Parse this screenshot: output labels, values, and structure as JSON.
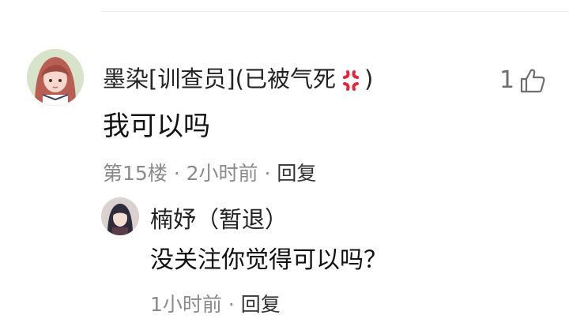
{
  "comment": {
    "username_prefix": "墨染[训查员](已被气死",
    "username_suffix": ")",
    "likes": "1",
    "text": "我可以吗",
    "floor": "第15楼",
    "sep1": " · ",
    "time": "2小时前",
    "sep2": " · ",
    "reply_label": "回复"
  },
  "reply": {
    "username": "楠妤（暂退）",
    "text": "没关注你觉得可以吗？",
    "time": "1小时前",
    "sep": " · ",
    "reply_label": "回复"
  },
  "icons": {
    "angry": "anger-emoji-icon",
    "like": "thumbs-up-icon"
  },
  "colors": {
    "angry": "#e0283a",
    "meta_text": "#8a8a8a",
    "primary_text": "#111111"
  }
}
